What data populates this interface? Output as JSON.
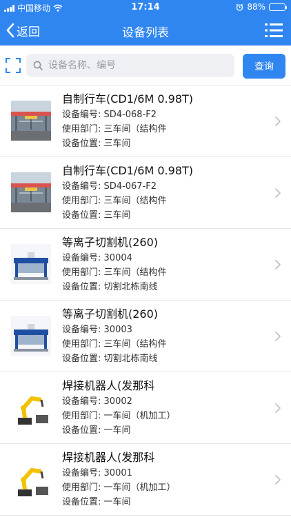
{
  "status_bar": {
    "carrier": "中国移动",
    "time": "17:14",
    "battery": "88%",
    "battery_level": 0.88
  },
  "nav": {
    "back_label": "返回",
    "title": "设备列表"
  },
  "search": {
    "placeholder": "设备名称、编号",
    "value": "",
    "query_label": "查询"
  },
  "colors": {
    "primary": "#2f86f0",
    "divider": "#e6e6e6"
  },
  "field_labels": {
    "code": "设备编号:",
    "dept": "使用部门:",
    "location": "设备位置:"
  },
  "devices": [
    {
      "name": "自制行车(CD1/6M 0.98T)",
      "code": "SD4-068-F2",
      "dept": "三车间（结构件",
      "location": "三车间",
      "image": "crane-photo"
    },
    {
      "name": "自制行车(CD1/6M 0.98T)",
      "code": "SD4-067-F2",
      "dept": "三车间（结构件",
      "location": "三车间",
      "image": "crane-photo"
    },
    {
      "name": "等离子切割机(260)",
      "code": "30004",
      "dept": "三车间（结构件",
      "location": "切割北栋南线",
      "image": "plasma-cutter-photo"
    },
    {
      "name": "等离子切割机(260)",
      "code": "30003",
      "dept": "三车间（结构件",
      "location": "切割北栋南线",
      "image": "plasma-cutter-photo"
    },
    {
      "name": "焊接机器人(发那科",
      "code": "30002",
      "dept": "一车间（机加工）",
      "location": "一车间",
      "image": "welding-robot-photo"
    },
    {
      "name": "焊接机器人(发那科",
      "code": "30001",
      "dept": "一车间（机加工）",
      "location": "一车间",
      "image": "welding-robot-photo"
    }
  ]
}
